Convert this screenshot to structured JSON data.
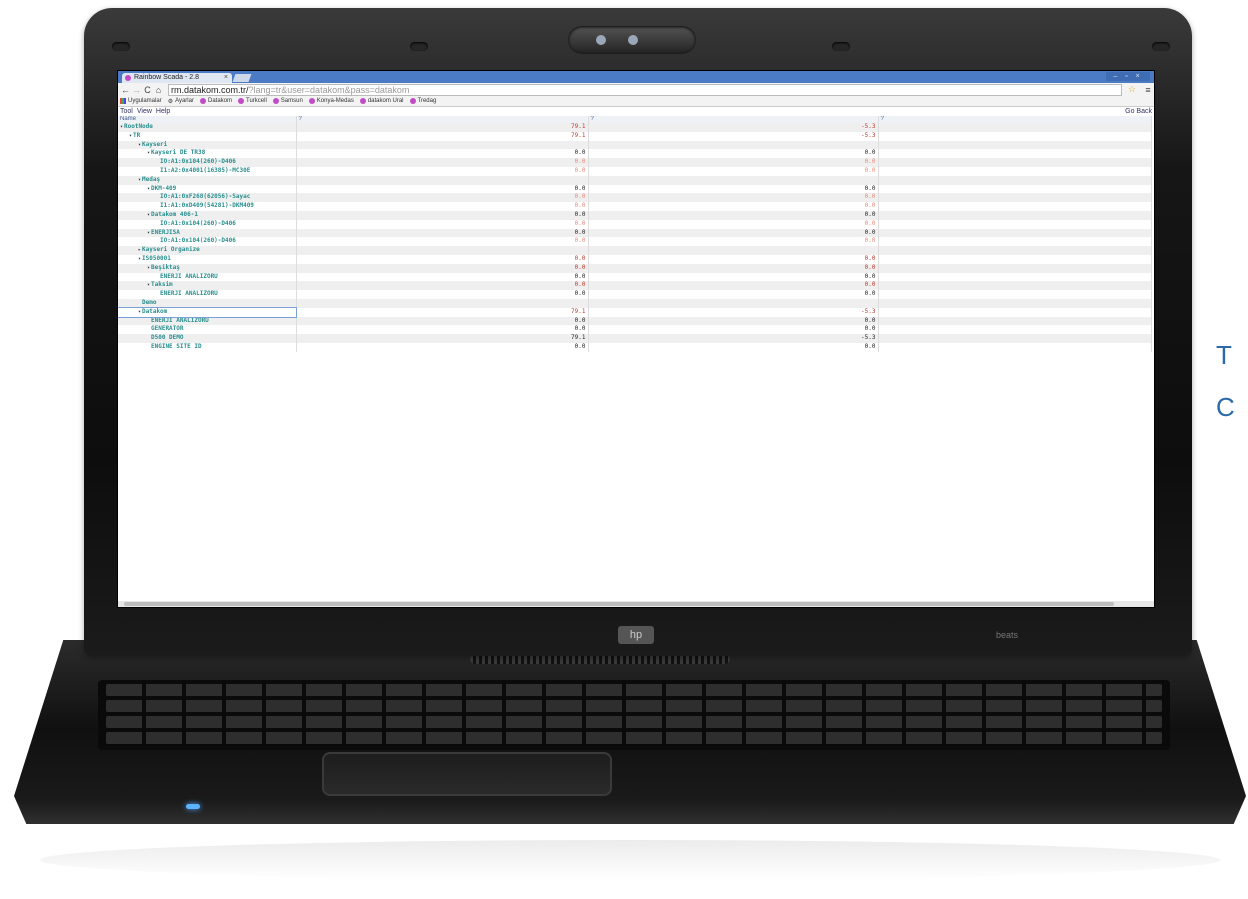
{
  "side_text": {
    "line1": "T",
    "line2": "C"
  },
  "browser": {
    "tab_title": "Rainbow Scada - 2.8",
    "tab_close": "× ",
    "url_host": "rm.datakom.com.tr/",
    "url_rest": "?lang=tr&user=datakom&pass=datakom",
    "window_controls": "– ▫ ×",
    "bookmarks": [
      "Uygulamalar",
      "Ayarlar",
      "Datakom",
      "Turkcell",
      "Samsun",
      "Konya-Medas",
      "datakom Ural",
      "Tredag"
    ]
  },
  "app": {
    "menu": [
      "Tool",
      "View",
      "Help"
    ],
    "go_back": "Go Back",
    "headers": [
      "Name",
      "?",
      "?",
      "?"
    ],
    "rows": [
      {
        "name": "RootNode",
        "indent": 0,
        "expander": "▾",
        "v1": "79.1",
        "v2": "-5.3",
        "c1": "red",
        "c2": "red"
      },
      {
        "name": "TR",
        "indent": 1,
        "expander": "▾",
        "v1": "79.1",
        "v2": "-5.3",
        "c1": "red",
        "c2": "red"
      },
      {
        "name": "Kayseri",
        "indent": 2,
        "expander": "▾",
        "v1": "",
        "v2": "",
        "c1": "blk",
        "c2": "blk"
      },
      {
        "name": "Kayseri DE TR38",
        "indent": 3,
        "expander": "▾",
        "v1": "0.0",
        "v2": "0.0",
        "c1": "blk",
        "c2": "blk"
      },
      {
        "name": "IO:A1:0x104(260)-D406",
        "indent": 4,
        "expander": "",
        "v1": "0.0",
        "v2": "0.0",
        "c1": "lred",
        "c2": "lred"
      },
      {
        "name": "I1:A2:0x4001(16385)-MC30E",
        "indent": 4,
        "expander": "",
        "v1": "0.0",
        "v2": "0.0",
        "c1": "lred",
        "c2": "lred"
      },
      {
        "name": "Medaş",
        "indent": 2,
        "expander": "▾",
        "v1": "",
        "v2": "",
        "c1": "blk",
        "c2": "blk"
      },
      {
        "name": "DKM-409",
        "indent": 3,
        "expander": "▾",
        "v1": "0.0",
        "v2": "0.0",
        "c1": "blk",
        "c2": "blk"
      },
      {
        "name": "IO:A1:0xF268(62056)-Sayac",
        "indent": 4,
        "expander": "",
        "v1": "0.0",
        "v2": "0.0",
        "c1": "lred",
        "c2": "lred"
      },
      {
        "name": "I1:A1:0xD409(54281)-DKM409",
        "indent": 4,
        "expander": "",
        "v1": "0.0",
        "v2": "0.0",
        "c1": "lred",
        "c2": "lred"
      },
      {
        "name": "Datakom 406-1",
        "indent": 3,
        "expander": "▾",
        "v1": "0.0",
        "v2": "0.0",
        "c1": "blk",
        "c2": "blk"
      },
      {
        "name": "IO:A1:0x104(260)-D406",
        "indent": 4,
        "expander": "",
        "v1": "0.0",
        "v2": "0.0",
        "c1": "lred",
        "c2": "lred"
      },
      {
        "name": "ENERJISA",
        "indent": 3,
        "expander": "▾",
        "v1": "0.0",
        "v2": "0.0",
        "c1": "blk",
        "c2": "blk"
      },
      {
        "name": "IO:A1:0x104(260)-D406",
        "indent": 4,
        "expander": "",
        "v1": "0.0",
        "v2": "0.0",
        "c1": "lred",
        "c2": "lred"
      },
      {
        "name": "Kayseri Organize",
        "indent": 2,
        "expander": "▸",
        "v1": "",
        "v2": "",
        "c1": "blk",
        "c2": "blk"
      },
      {
        "name": "IS050001",
        "indent": 2,
        "expander": "▾",
        "v1": "0.0",
        "v2": "0.0",
        "c1": "red",
        "c2": "red"
      },
      {
        "name": "Beşiktaş",
        "indent": 3,
        "expander": "▾",
        "v1": "0.0",
        "v2": "0.0",
        "c1": "red",
        "c2": "red"
      },
      {
        "name": "ENERJI ANALIZORU",
        "indent": 4,
        "expander": "",
        "v1": "0.0",
        "v2": "0.0",
        "c1": "blk",
        "c2": "blk"
      },
      {
        "name": "Taksim",
        "indent": 3,
        "expander": "▾",
        "v1": "0.0",
        "v2": "0.0",
        "c1": "red",
        "c2": "red"
      },
      {
        "name": "ENERJI ANALIZORU",
        "indent": 4,
        "expander": "",
        "v1": "0.0",
        "v2": "0.0",
        "c1": "blk",
        "c2": "blk"
      },
      {
        "name": "Demo",
        "indent": 2,
        "expander": "",
        "v1": "",
        "v2": "",
        "c1": "blk",
        "c2": "blk"
      },
      {
        "name": "Datakom",
        "indent": 2,
        "expander": "▾",
        "v1": "79.1",
        "v2": "-5.3",
        "c1": "red",
        "c2": "red",
        "selected": true
      },
      {
        "name": "ENERJI ANALIZORU",
        "indent": 3,
        "expander": "",
        "v1": "0.0",
        "v2": "0.0",
        "c1": "blk",
        "c2": "blk"
      },
      {
        "name": "GENERATOR",
        "indent": 3,
        "expander": "",
        "v1": "0.0",
        "v2": "0.0",
        "c1": "blk",
        "c2": "blk"
      },
      {
        "name": "D500 DEMO",
        "indent": 3,
        "expander": "",
        "v1": "79.1",
        "v2": "-5.3",
        "c1": "blk",
        "c2": "blk"
      },
      {
        "name": "ENGINE SITE ID",
        "indent": 3,
        "expander": "",
        "v1": "0.0",
        "v2": "0.0",
        "c1": "blk",
        "c2": "blk"
      }
    ]
  },
  "laptop": {
    "logo": "hp",
    "beats": "beats"
  }
}
